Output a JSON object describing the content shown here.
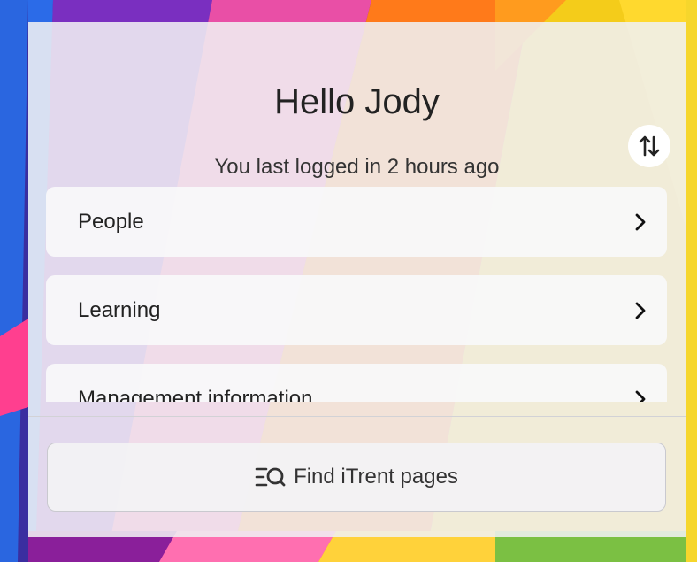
{
  "greeting": "Hello Jody",
  "last_login": "You last logged in 2 hours ago",
  "sort_icon": "sort-up-down-icon",
  "menu": {
    "items": [
      {
        "label": "People",
        "icon": "chevron-right-icon"
      },
      {
        "label": "Learning",
        "icon": "chevron-right-icon"
      },
      {
        "label": "Management information",
        "icon": "chevron-right-icon"
      }
    ]
  },
  "find_button": {
    "label": "Find iTrent pages",
    "icon": "menu-search-icon"
  },
  "colors": {
    "panel": "#f0f0f2",
    "text": "#222222",
    "item_bg": "#f8f8fa"
  }
}
